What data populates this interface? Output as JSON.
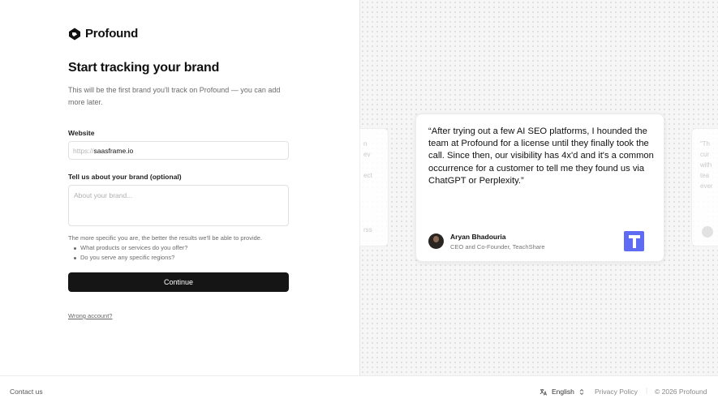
{
  "brand": {
    "name": "Profound"
  },
  "heading": "Start tracking your brand",
  "subtitle": "This will be the first brand you'll track on Profound — you can add more later.",
  "website": {
    "label": "Website",
    "prefix": "https://",
    "value": "saasframe.io"
  },
  "about": {
    "label": "Tell us about your brand (optional)",
    "placeholder": "About your brand..."
  },
  "hint": {
    "intro": "The more specific you are, the better the results we'll be able to provide.",
    "items": [
      "What products or services do you offer?",
      "Do you serve any specific regions?"
    ]
  },
  "continue_label": "Continue",
  "wrong_account": "Wrong account?",
  "testimonial": {
    "quote": "“After trying out a few AI SEO platforms, I hounded the team at Profound for a license until they finally took the call. Since then, our visibility has 4x'd and it's a common occurrence for a customer to tell me they found us via ChatGPT or Perplexity.”",
    "name": "Aryan Bhadouria",
    "role": "CEO and Co-Founder, TeachShare",
    "company_logo_letter": "T",
    "company_color": "#5e6bf2"
  },
  "ghost_left": [
    "n",
    "ev",
    "",
    "ect",
    "",
    "",
    "",
    "",
    "",
    "rss"
  ],
  "ghost_right": [
    "“Th",
    "cur",
    "with",
    "tea",
    "ever"
  ],
  "footer": {
    "contact": "Contact us",
    "language": "English",
    "privacy": "Privacy Policy",
    "copyright": "© 2026 Profound"
  }
}
